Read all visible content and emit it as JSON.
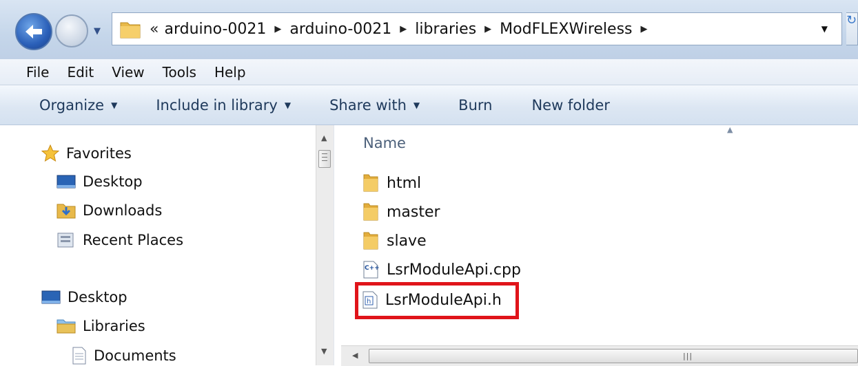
{
  "address": {
    "overflow": "«",
    "crumbs": [
      "arduino-0021",
      "arduino-0021",
      "libraries",
      "ModFLEXWireless"
    ]
  },
  "menu": [
    "File",
    "Edit",
    "View",
    "Tools",
    "Help"
  ],
  "commands": {
    "organize": "Organize",
    "include_in_library": "Include in library",
    "share_with": "Share with",
    "burn": "Burn",
    "new_folder": "New folder"
  },
  "nav": {
    "favorites": "Favorites",
    "fav_desktop": "Desktop",
    "downloads": "Downloads",
    "recent_places": "Recent Places",
    "desktop": "Desktop",
    "libraries": "Libraries",
    "documents": "Documents"
  },
  "files": {
    "column_name": "Name",
    "items": [
      {
        "name": "html",
        "type": "folder"
      },
      {
        "name": "master",
        "type": "folder"
      },
      {
        "name": "slave",
        "type": "folder"
      },
      {
        "name": "LsrModuleApi.cpp",
        "type": "cpp"
      },
      {
        "name": "LsrModuleApi.h",
        "type": "h"
      }
    ]
  },
  "colors": {
    "highlight": "#e0141a",
    "command_text": "#1e395b"
  }
}
